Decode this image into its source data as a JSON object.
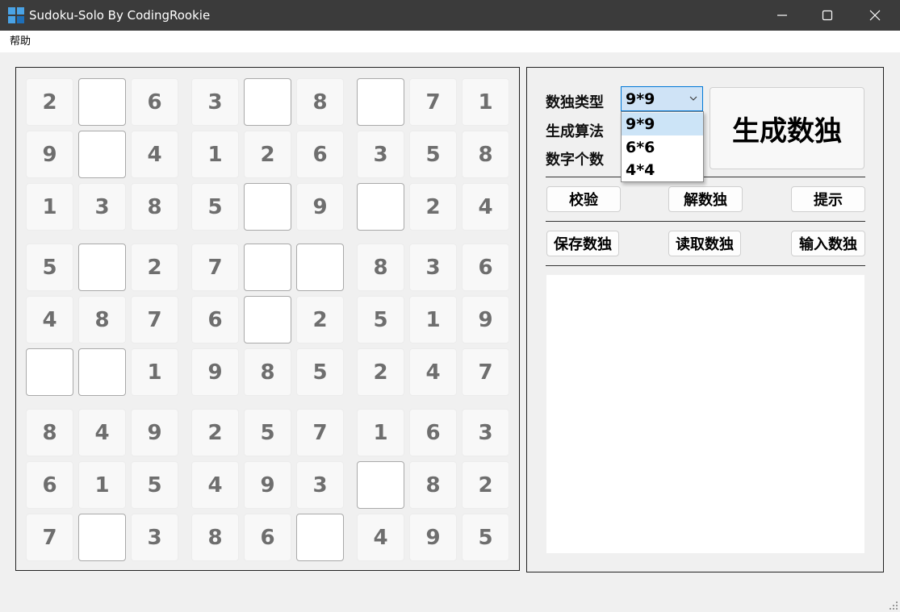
{
  "window": {
    "title": "Sudoku-Solo By CodingRookie",
    "controls": [
      "minimize",
      "maximize",
      "close"
    ],
    "app_icon": "sudoku-grid-icon",
    "titlebar_color": "#3b3b3b"
  },
  "menu": {
    "items": [
      "帮助"
    ]
  },
  "board": {
    "rows": [
      [
        "2",
        "",
        "6",
        "3",
        "",
        "8",
        "",
        "7",
        "1"
      ],
      [
        "9",
        "",
        "4",
        "1",
        "2",
        "6",
        "3",
        "5",
        "8"
      ],
      [
        "1",
        "3",
        "8",
        "5",
        "",
        "9",
        "",
        "2",
        "4"
      ],
      [
        "5",
        "",
        "2",
        "7",
        "",
        "",
        "8",
        "3",
        "6"
      ],
      [
        "4",
        "8",
        "7",
        "6",
        "",
        "2",
        "5",
        "1",
        "9"
      ],
      [
        "",
        "",
        "1",
        "9",
        "8",
        "5",
        "2",
        "4",
        "7"
      ],
      [
        "8",
        "4",
        "9",
        "2",
        "5",
        "7",
        "1",
        "6",
        "3"
      ],
      [
        "6",
        "1",
        "5",
        "4",
        "9",
        "3",
        "",
        "8",
        "2"
      ],
      [
        "7",
        "",
        "3",
        "8",
        "6",
        "",
        "4",
        "9",
        "5"
      ]
    ]
  },
  "controls": {
    "type_label": "数独类型",
    "algo_label": "生成算法",
    "count_label": "数字个数",
    "type_select": {
      "value": "9*9",
      "options": [
        "9*9",
        "6*6",
        "4*4"
      ],
      "highlighted": "9*9"
    },
    "generate_label": "生成数独",
    "check_label": "校验",
    "solve_label": "解数独",
    "hint_label": "提示",
    "save_label": "保存数独",
    "load_label": "读取数独",
    "input_label": "输入数独",
    "output_text": ""
  },
  "colors": {
    "accent": "#0078d7",
    "selected_bg": "#cce4f7",
    "given_text": "#6e6e6e"
  }
}
